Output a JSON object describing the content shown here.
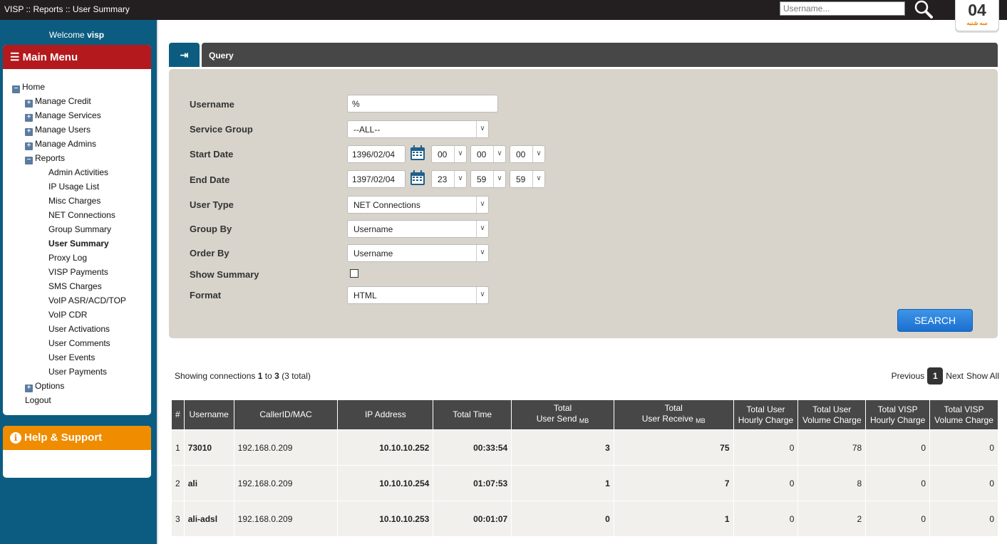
{
  "topbar": {
    "breadcrumb": "VISP :: Reports :: User Summary",
    "search_placeholder": "Username...",
    "calendar_day": "04",
    "calendar_weekday": "سه شنبه"
  },
  "sidebar": {
    "welcome_prefix": "Welcome",
    "welcome_user": "visp",
    "main_menu_title": "Main Menu",
    "help_title": "Help & Support",
    "items": [
      {
        "label": "Home",
        "type": "minus",
        "level": 0
      },
      {
        "label": "Manage Credit",
        "type": "plus",
        "level": 1
      },
      {
        "label": "Manage Services",
        "type": "plus",
        "level": 1
      },
      {
        "label": "Manage Users",
        "type": "plus",
        "level": 1
      },
      {
        "label": "Manage Admins",
        "type": "plus",
        "level": 1
      },
      {
        "label": "Reports",
        "type": "minus",
        "level": 1
      },
      {
        "label": "Admin Activities",
        "level": 2
      },
      {
        "label": "IP Usage List",
        "level": 2
      },
      {
        "label": "Misc Charges",
        "level": 2
      },
      {
        "label": "NET Connections",
        "level": 2
      },
      {
        "label": "Group Summary",
        "level": 2
      },
      {
        "label": "User Summary",
        "level": 2,
        "active": true
      },
      {
        "label": "Proxy Log",
        "level": 2
      },
      {
        "label": "VISP Payments",
        "level": 2
      },
      {
        "label": "SMS Charges",
        "level": 2
      },
      {
        "label": "VoIP ASR/ACD/TOP",
        "level": 2
      },
      {
        "label": "VoIP CDR",
        "level": 2
      },
      {
        "label": "User Activations",
        "level": 2
      },
      {
        "label": "User Comments",
        "level": 2
      },
      {
        "label": "User Events",
        "level": 2
      },
      {
        "label": "User Payments",
        "level": 2
      },
      {
        "label": "Options",
        "type": "plus",
        "level": 1
      },
      {
        "label": "Logout",
        "level": 1
      }
    ]
  },
  "query": {
    "title": "Query",
    "username_label": "Username",
    "username_value": "%",
    "service_group_label": "Service Group",
    "service_group_value": "--ALL--",
    "start_date_label": "Start Date",
    "start_date": "1396/02/04",
    "start_h": "00",
    "start_m": "00",
    "start_s": "00",
    "end_date_label": "End Date",
    "end_date": "1397/02/04",
    "end_h": "23",
    "end_m": "59",
    "end_s": "59",
    "user_type_label": "User Type",
    "user_type_value": "NET Connections",
    "group_by_label": "Group By",
    "group_by_value": "Username",
    "order_by_label": "Order By",
    "order_by_value": "Username",
    "show_summary_label": "Show Summary",
    "show_summary_checked": false,
    "format_label": "Format",
    "format_value": "HTML",
    "search_label": "SEARCH"
  },
  "results": {
    "showing_prefix": "Showing connections",
    "from": "1",
    "to_word": "to",
    "to": "3",
    "total": "(3 total)",
    "pager": {
      "previous": "Previous",
      "current": "1",
      "next": "Next",
      "show_all": "Show All"
    },
    "columns": [
      "#",
      "Username",
      "CallerID/MAC",
      "IP Address",
      "Total Time",
      "Total\nUser Send",
      "Total\nUser Receive",
      "Total User Hourly Charge",
      "Total User Volume Charge",
      "Total VISP Hourly Charge",
      "Total VISP Volume Charge"
    ],
    "unit": "MB",
    "rows": [
      [
        "1",
        "73010",
        "192.168.0.209",
        "10.10.10.252",
        "00:33:54",
        "3",
        "75",
        "0",
        "78",
        "0",
        "0"
      ],
      [
        "2",
        "ali",
        "192.168.0.209",
        "10.10.10.254",
        "01:07:53",
        "1",
        "7",
        "0",
        "8",
        "0",
        "0"
      ],
      [
        "3",
        "ali-adsl",
        "192.168.0.209",
        "10.10.10.253",
        "00:01:07",
        "0",
        "1",
        "0",
        "2",
        "0",
        "0"
      ]
    ]
  }
}
